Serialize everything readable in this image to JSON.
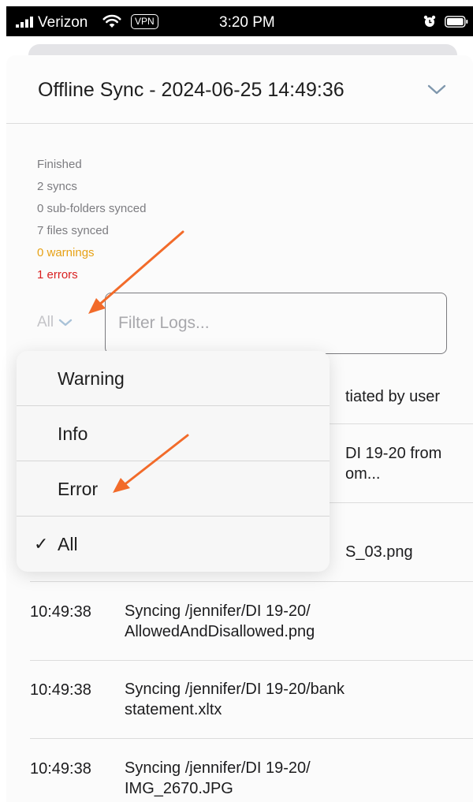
{
  "status_bar": {
    "carrier": "Verizon",
    "vpn": "VPN",
    "time": "3:20 PM"
  },
  "sheet": {
    "title": "Offline Sync - 2024-06-25 14:49:36"
  },
  "summary": {
    "status": "Finished",
    "syncs": "2 syncs",
    "subfolders": "0 sub-folders synced",
    "files": "7 files synced",
    "warnings": "0 warnings",
    "errors": "1 errors"
  },
  "filter": {
    "level_value": "All",
    "placeholder": "Filter Logs..."
  },
  "logs": {
    "hidden": [
      {
        "text": "tiated by user"
      },
      {
        "text": "DI 19-20 from\nom..."
      },
      {
        "text": "S_03.png"
      }
    ],
    "rows": [
      {
        "time": "10:49:38",
        "message": "Syncing /jennifer/DI 19-20/\nAllowedAndDisallowed.png"
      },
      {
        "time": "10:49:38",
        "message": "Syncing /jennifer/DI 19-20/bank\nstatement.xltx"
      },
      {
        "time": "10:49:38",
        "message": "Syncing /jennifer/DI 19-20/\nIMG_2670.JPG"
      }
    ]
  },
  "menu": {
    "items": [
      {
        "label": "Warning"
      },
      {
        "label": "Info"
      },
      {
        "label": "Error"
      },
      {
        "label": "All",
        "checkmark": "✓"
      }
    ]
  },
  "colors": {
    "warning": "#e7a115",
    "error": "#d92020",
    "annotation_arrow": "#f26b2a"
  }
}
